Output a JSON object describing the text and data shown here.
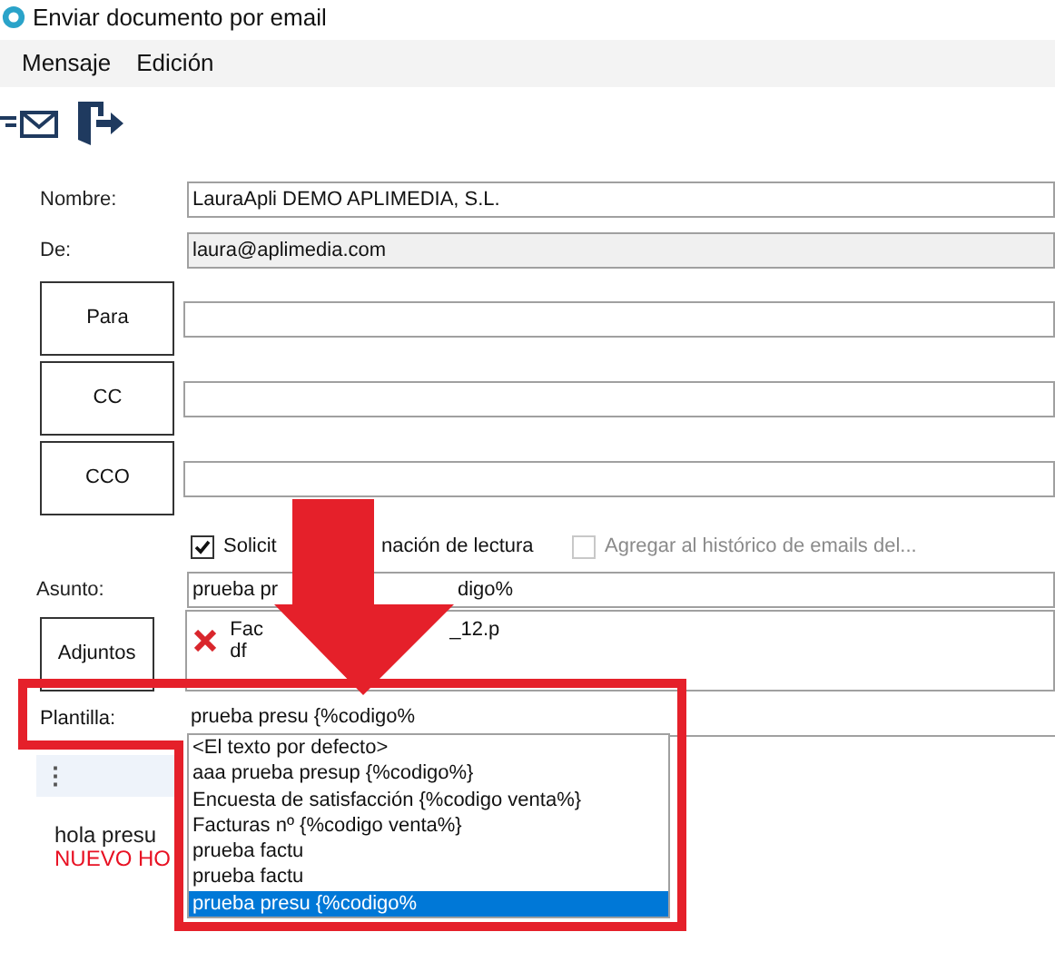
{
  "window": {
    "title": "Enviar documento por email"
  },
  "menu": [
    "Mensaje",
    "Edición"
  ],
  "form": {
    "nombre": {
      "label": "Nombre:",
      "value": "LauraApli DEMO APLIMEDIA, S.L."
    },
    "de": {
      "label": "De:",
      "value": "laura@aplimedia.com"
    },
    "recipients": [
      {
        "button": "Para"
      },
      {
        "button": "CC"
      },
      {
        "button": "CCO"
      }
    ],
    "options": [
      {
        "label_parts": [
          "Solicit",
          "nación de lectura"
        ],
        "checked": true,
        "disabled": false
      },
      {
        "label_parts": [
          "Agregar al histórico de emails del..."
        ],
        "checked": false,
        "disabled": true
      }
    ],
    "asunto": {
      "label": "Asunto:",
      "value_parts": [
        "prueba pr",
        "digo%"
      ]
    },
    "adjuntos": {
      "button": "Adjuntos",
      "files": [
        {
          "lines": [
            [
              "Fac",
              "_12.p"
            ],
            [
              "df"
            ]
          ]
        }
      ]
    },
    "plantilla": {
      "label": "Plantilla:",
      "value": "prueba presu {%codigo%",
      "options": [
        {
          "label": "<El texto por defecto>",
          "selected": false
        },
        {
          "label": "aaa prueba presup {%codigo%}",
          "selected": false
        },
        {
          "label": "Encuesta de satisfacción {%codigo venta%}",
          "selected": false
        },
        {
          "label": "Facturas nº {%codigo venta%}",
          "selected": false
        },
        {
          "label": "prueba factu",
          "selected": false
        },
        {
          "label": "prueba factu",
          "selected": false
        },
        {
          "label": "prueba presu {%codigo%",
          "selected": true
        }
      ]
    }
  },
  "editor": {
    "toolbar_glyph": "⋮",
    "lines": [
      {
        "text": "hola presu",
        "color": "#1a1a1a"
      },
      {
        "text": "NUEVO HO",
        "color": "#e81123"
      }
    ]
  }
}
